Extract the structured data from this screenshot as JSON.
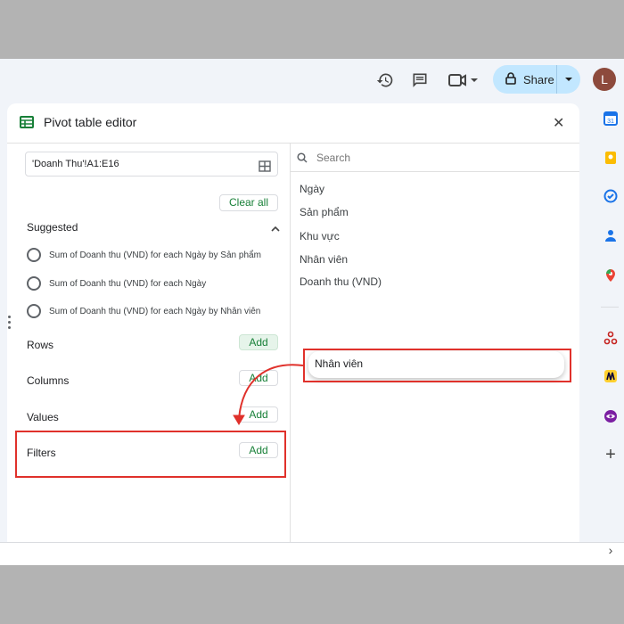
{
  "toolbar": {
    "history_icon": "history-icon",
    "comment_icon": "comment-icon",
    "meet_icon": "video-camera-icon",
    "share_label": "Share",
    "avatar_initial": "L"
  },
  "pivot_editor": {
    "title": "Pivot table editor",
    "range": "'Doanh Thu'!A1:E16",
    "clear_all": "Clear all",
    "suggested_label": "Suggested",
    "suggestions": [
      "Sum of Doanh thu (VND) for each Ngày by Sản phẩm",
      "Sum of Doanh thu (VND) for each Ngày",
      "Sum of Doanh thu (VND) for each Ngày by Nhân viên"
    ],
    "rows_label": "Rows",
    "columns_label": "Columns",
    "values_label": "Values",
    "filters_label": "Filters",
    "add_label": "Add"
  },
  "fields_panel": {
    "search_placeholder": "Search",
    "fields": [
      "Ngày",
      "Sản phẩm",
      "Khu vực",
      "Nhân viên",
      "Doanh thu (VND)"
    ],
    "dragging_field": "Nhân viên"
  },
  "colors": {
    "accent_green": "#188038",
    "highlight_red": "#e0312b",
    "share_bg": "#c2e7ff",
    "avatar_bg": "#8d4a3c"
  }
}
